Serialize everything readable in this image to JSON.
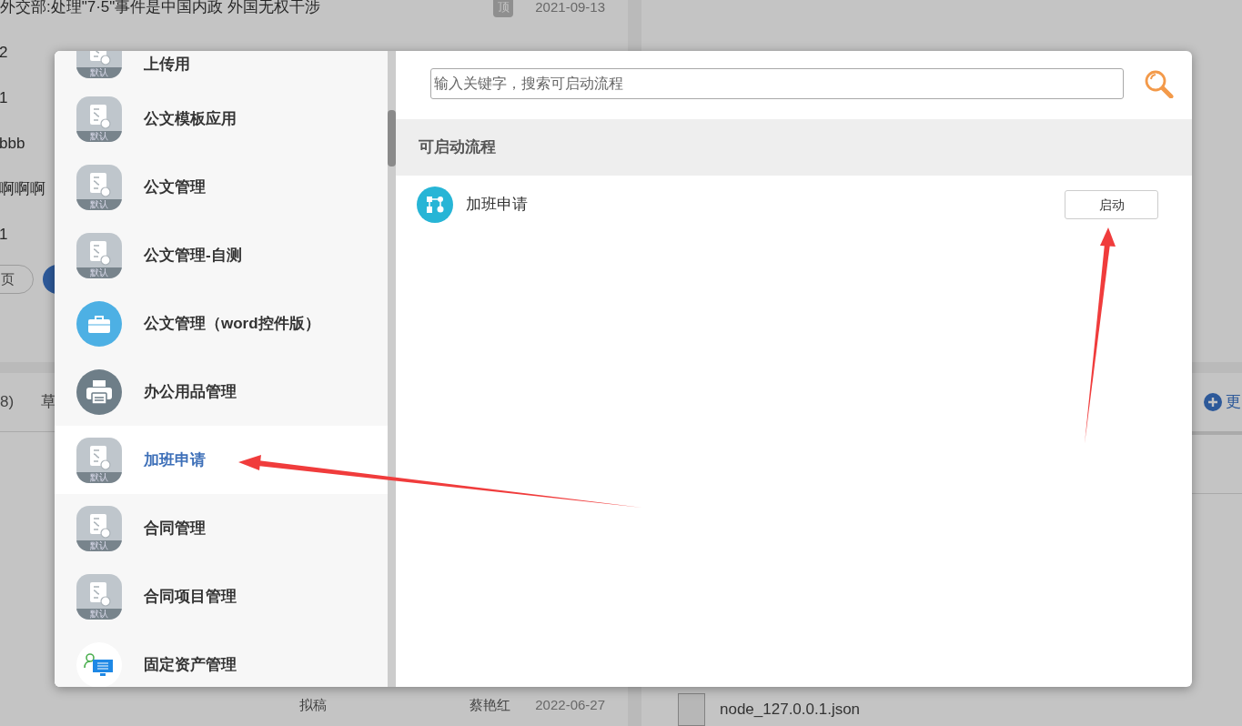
{
  "background": {
    "notices": [
      {
        "title": "外交部:处理\"7·5\"事件是中国内政 外国无权干涉",
        "badge": "顶",
        "date": "2021-09-13"
      }
    ],
    "rows": [
      "2",
      "1",
      "bbb",
      "啊啊啊",
      "1"
    ],
    "pager": {
      "label": "页"
    },
    "section": {
      "count": "8)",
      "tab": "草",
      "more": "更"
    },
    "bottom_row": {
      "type": "拟稿",
      "author": "蔡艳红",
      "date": "2022-06-27"
    },
    "file": {
      "name": "node_127.0.0.1.json"
    }
  },
  "dialog": {
    "categories": [
      {
        "label": "上传用",
        "kind": "default",
        "badge": "默认",
        "selected": false
      },
      {
        "label": "公文模板应用",
        "kind": "default",
        "badge": "默认",
        "selected": false
      },
      {
        "label": "公文管理",
        "kind": "default",
        "badge": "默认",
        "selected": false
      },
      {
        "label": "公文管理-自测",
        "kind": "default",
        "badge": "默认",
        "selected": false
      },
      {
        "label": "公文管理（word控件版）",
        "kind": "toolbox",
        "selected": false
      },
      {
        "label": "办公用品管理",
        "kind": "printer",
        "selected": false
      },
      {
        "label": "加班申请",
        "kind": "default",
        "badge": "默认",
        "selected": true
      },
      {
        "label": "合同管理",
        "kind": "default",
        "badge": "默认",
        "selected": false
      },
      {
        "label": "合同项目管理",
        "kind": "default",
        "badge": "默认",
        "selected": false
      },
      {
        "label": "固定资产管理",
        "kind": "asset",
        "selected": false
      }
    ],
    "search": {
      "placeholder": "输入关键字，搜索可启动流程"
    },
    "section_title": "可启动流程",
    "processes": [
      {
        "name": "加班申请",
        "action": "启动"
      }
    ]
  }
}
